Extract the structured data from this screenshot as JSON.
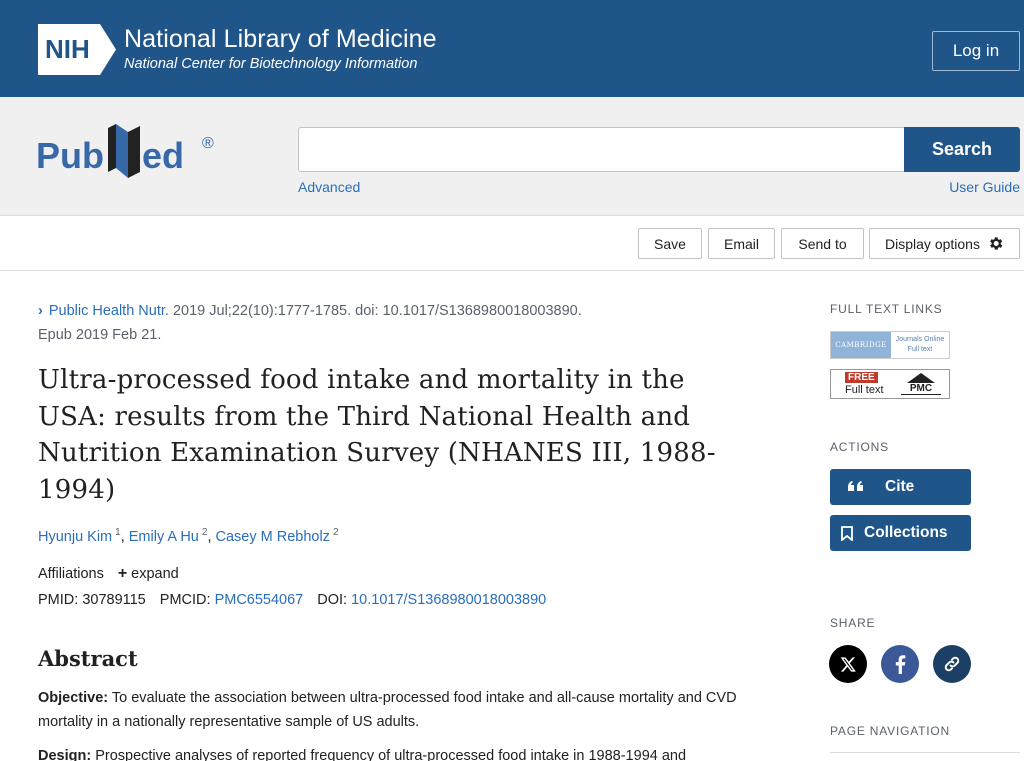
{
  "header": {
    "nih_abbr": "NIH",
    "title": "National Library of Medicine",
    "subtitle": "National Center for Biotechnology Information",
    "login_label": "Log in"
  },
  "search": {
    "logo_text": "PubMed",
    "input_value": "",
    "button_label": "Search",
    "advanced_label": "Advanced",
    "user_guide_label": "User Guide"
  },
  "toolbar": {
    "save": "Save",
    "email": "Email",
    "send_to": "Send to",
    "display_options": "Display options"
  },
  "article": {
    "journal": "Public Health Nutr.",
    "citation": " 2019 Jul;22(10):1777-1785. doi: 10.1017/S1368980018003890.",
    "epub": "Epub 2019 Feb 21.",
    "title": "Ultra-processed food intake and mortality in the USA: results from the Third National Health and Nutrition Examination Survey (NHANES III, 1988-1994)",
    "authors": [
      {
        "name": "Hyunju Kim",
        "aff": "1"
      },
      {
        "name": "Emily A Hu",
        "aff": "2"
      },
      {
        "name": "Casey M Rebholz",
        "aff": "2"
      }
    ],
    "affiliations_label": "Affiliations",
    "expand_label": "expand",
    "pmid_label": "PMID:",
    "pmid": "30789115",
    "pmcid_label": "PMCID:",
    "pmcid": "PMC6554067",
    "doi_label": "DOI:",
    "doi": "10.1017/S1368980018003890"
  },
  "abstract": {
    "heading": "Abstract",
    "objective_label": "Objective:",
    "objective_text": " To evaluate the association between ultra-processed food intake and all-cause mortality and CVD mortality in a nationally representative sample of US adults.",
    "design_label": "Design:",
    "design_text": " Prospective analyses of reported frequency of ultra-processed food intake in 1988-1994 and"
  },
  "sidebar": {
    "full_text_links": "FULL TEXT LINKS",
    "cambridge_left": "CAMBRIDGE",
    "cambridge_right_1": "Journals Online",
    "cambridge_right_2": "Full text",
    "pmc_free": "FREE",
    "pmc_full_text": "Full text",
    "pmc_logo": "PMC",
    "actions": "ACTIONS",
    "cite": "Cite",
    "collections": "Collections",
    "share": "SHARE",
    "page_navigation": "PAGE NAVIGATION"
  },
  "colors": {
    "nih_blue": "#20558a",
    "link_blue": "#2a6ebb",
    "facebook": "#3b5998",
    "permalink": "#1d3f66"
  }
}
